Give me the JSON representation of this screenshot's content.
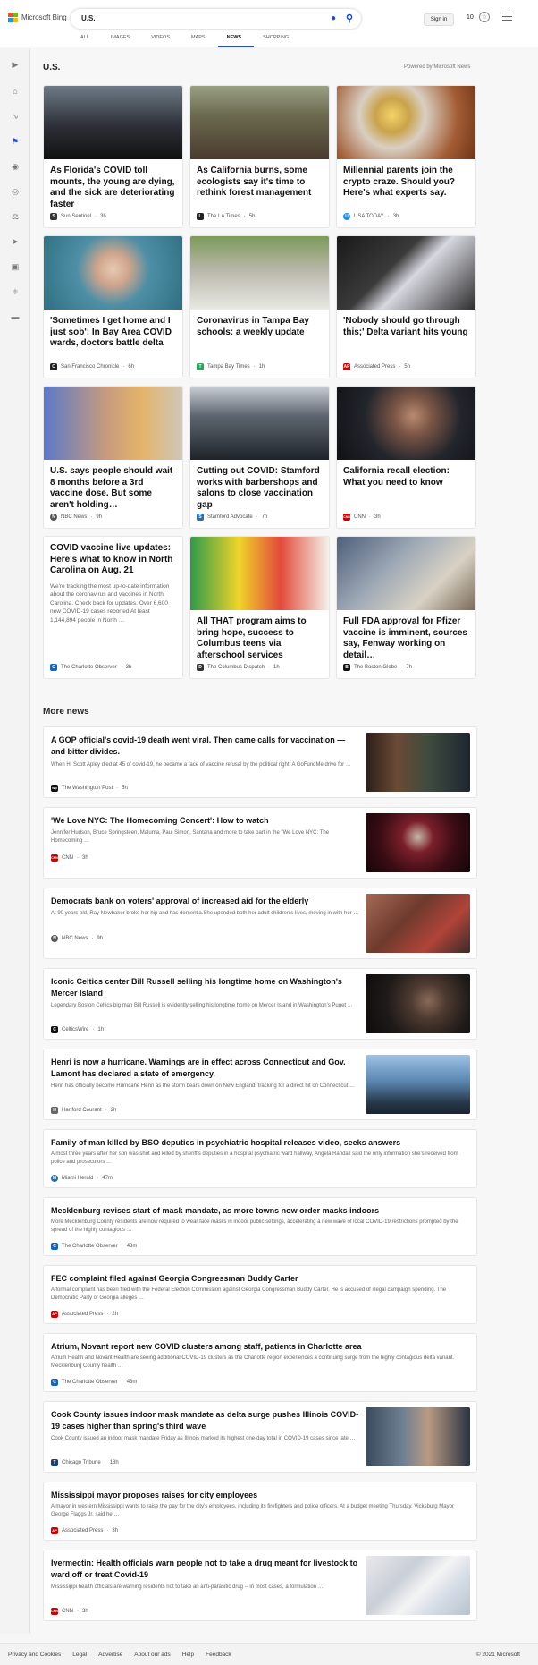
{
  "header": {
    "brand": "Microsoft Bing",
    "query": "U.S.",
    "signin": "Sign in",
    "points": "10",
    "tabs": [
      "ALL",
      "IMAGES",
      "VIDEOS",
      "MAPS",
      "NEWS",
      "SHOPPING"
    ],
    "active_tab": "NEWS"
  },
  "section": {
    "title": "U.S.",
    "powered": "Powered by Microsoft News"
  },
  "cards": [
    {
      "title": "As Florida's COVID toll mounts, the young are dying, and the sick are deteriorating faster",
      "source": "Sun Sentinel",
      "time": "3h",
      "icon": "S"
    },
    {
      "title": "As California burns, some ecologists say it's time to rethink forest management",
      "source": "The LA Times",
      "time": "5h",
      "icon": "L"
    },
    {
      "title": "Millennial parents join the crypto craze. Should you? Here's what experts say.",
      "source": "USA TODAY",
      "time": "3h",
      "icon": "U"
    },
    {
      "title": "'Sometimes I get home and I just sob': In Bay Area COVID wards, doctors battle delta",
      "source": "San Francisco Chronicle",
      "time": "6h",
      "icon": "C"
    },
    {
      "title": "Coronavirus in Tampa Bay schools: a weekly update",
      "source": "Tampa Bay Times",
      "time": "1h",
      "icon": "T"
    },
    {
      "title": "'Nobody should go through this;' Delta variant hits young",
      "source": "Associated Press",
      "time": "5h",
      "icon": "AP"
    },
    {
      "title": "U.S. says people should wait 8 months before a 3rd vaccine dose. But some aren't holding…",
      "source": "NBC News",
      "time": "9h",
      "icon": "N"
    },
    {
      "title": "Cutting out COVID: Stamford works with barbershops and salons to close vaccination gap",
      "source": "Stamford Advocate",
      "time": "7h",
      "icon": "S"
    },
    {
      "title": "California recall election: What you need to know",
      "source": "CNN",
      "time": "3h",
      "icon": "CNN"
    },
    {
      "title": "COVID vaccine live updates: Here's what to know in North Carolina on Aug. 21",
      "snippet": "We're tracking the most up-to-date information about the coronavirus and vaccines in North Carolina. Check back for updates. Over 6,600 new COVID-19 cases reported At least 1,144,894 people in North …",
      "source": "The Charlotte Observer",
      "time": "3h",
      "icon": "C"
    },
    {
      "title": "All THAT program aims to bring hope, success to Columbus teens via afterschool services",
      "source": "The Columbus Dispatch",
      "time": "1h",
      "icon": "D"
    },
    {
      "title": "Full FDA approval for Pfizer vaccine is imminent, sources say, Fenway working on detail…",
      "source": "The Boston Globe",
      "time": "7h",
      "icon": "B"
    }
  ],
  "more_news": {
    "title": "More news",
    "items": [
      {
        "title": "A GOP official's covid-19 death went viral. Then came calls for vaccination — and bitter divides.",
        "snippet": "When H. Scott Apley died at 45 of covid-19, he became a face of vaccine refusal by the political right. A GoFundMe drive for …",
        "source": "The Washington Post",
        "time": "5h",
        "icon": "wp"
      },
      {
        "title": "'We Love NYC: The Homecoming Concert': How to watch",
        "snippet": "Jennifer Hudson, Bruce Springsteen, Maluma, Paul Simon, Santana and more to take part in the \"We Love NYC: The Homecoming …",
        "source": "CNN",
        "time": "3h",
        "icon": "CNN"
      },
      {
        "title": "Democrats bank on voters' approval of increased aid for the elderly",
        "snippet": "At 90 years old, Ray Newbaker broke her hip and has dementia.She upended both her adult children's lives, moving in with her …",
        "source": "NBC News",
        "time": "9h",
        "icon": "N"
      },
      {
        "title": "Iconic Celtics center Bill Russell selling his longtime home on Washington's Mercer Island",
        "snippet": "Legendary Boston Celtics big man Bill Russell is evidently selling his longtime home on Mercer Island in Washington's Puget …",
        "source": "CelticsWire",
        "time": "1h",
        "icon": "C"
      },
      {
        "title": "Henri is now a hurricane. Warnings are in effect across Connecticut and Gov. Lamont has declared a state of emergency.",
        "snippet": "Henri has officially become Hurricane Henri as the storm bears down on New England, tracking for a direct hit on Connecticut …",
        "source": "Hartford Courant",
        "time": "2h",
        "icon": "H"
      },
      {
        "title": "Family of man killed by BSO deputies in psychiatric hospital releases video, seeks answers",
        "snippet": "Almost three years after her son was shot and killed by sheriff's deputies in a hospital psychiatric ward hallway, Angela Randall said the only information she's received from police and prosecutors …",
        "source": "Miami Herald",
        "time": "47m",
        "icon": "M"
      },
      {
        "title": "Mecklenburg revises start of mask mandate, as more towns now order masks indoors",
        "snippet": "More Mecklenburg County residents are now required to wear face masks in indoor public settings, accelerating a new wave of local COVID-19 restrictions prompted by the spread of the highly contagious …",
        "source": "The Charlotte Observer",
        "time": "43m",
        "icon": "C"
      },
      {
        "title": "FEC complaint filed against Georgia Congressman Buddy Carter",
        "snippet": "A formal complaint has been filed with the Federal Election Commission against Georgia Congressman Buddy Carter. He is accused of illegal campaign spending. The Democratic Party of Georgia alleges …",
        "source": "Associated Press",
        "time": "2h",
        "icon": "AP"
      },
      {
        "title": "Atrium, Novant report new COVID clusters among staff, patients in Charlotte area",
        "snippet": "Atrium Health and Novant Health are seeing additional COVID-19 clusters as the Charlotte region experiences a continuing surge from the highly contagious delta variant. Mecklenburg County health …",
        "source": "The Charlotte Observer",
        "time": "43m",
        "icon": "C"
      },
      {
        "title": "Cook County issues indoor mask mandate as delta surge pushes Illinois COVID-19 cases higher than spring's third wave",
        "snippet": "Cook County issued an indoor mask mandate Friday as Illinois marked its highest one-day total in COVID-19 cases since late …",
        "source": "Chicago Tribune",
        "time": "18h",
        "icon": "T"
      },
      {
        "title": "Mississippi mayor proposes raises for city employees",
        "snippet": "A mayor in western Mississippi wants to raise the pay for the city's employees, including its firefighters and police officers. At a budget meeting Thursday, Vicksburg Mayor George Flaggs Jr. said he …",
        "source": "Associated Press",
        "time": "3h",
        "icon": "AP"
      },
      {
        "title": "Ivermectin: Health officials warn people not to take a drug meant for livestock to ward off or treat Covid-19",
        "snippet": "Mississippi health officials are warning residents not to take an anti-parasitic drug -- in most cases, a formulation …",
        "source": "CNN",
        "time": "3h",
        "icon": "CNN"
      }
    ]
  },
  "footer": {
    "links": [
      "Privacy and Cookies",
      "Legal",
      "Advertise",
      "About our ads",
      "Help",
      "Feedback"
    ],
    "copyright": "© 2021 Microsoft"
  },
  "colors": {
    "accent": "#174ae4",
    "bg": "#f7f7f7"
  }
}
